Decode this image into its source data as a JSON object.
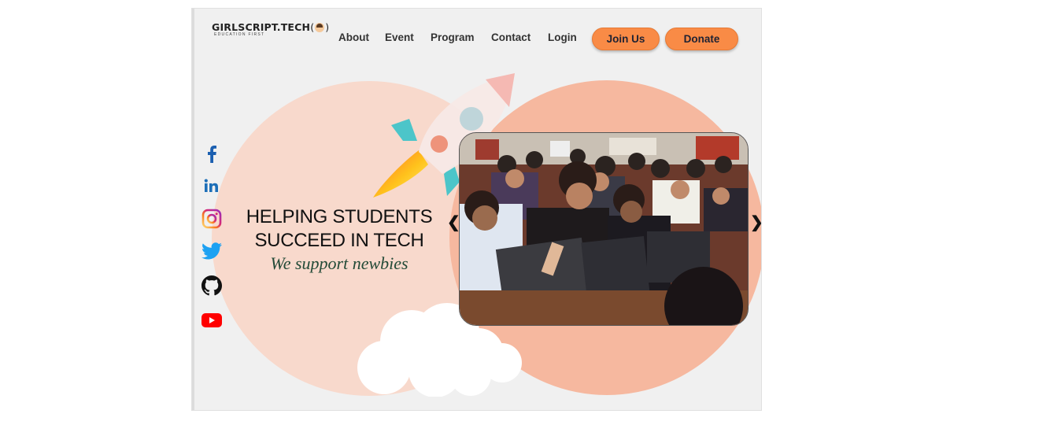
{
  "logo": {
    "name": "GIRLSCRIPT.TECH",
    "tagline": "EDUCATION FIRST"
  },
  "nav": [
    {
      "label": "About"
    },
    {
      "label": "Event"
    },
    {
      "label": "Program"
    },
    {
      "label": "Contact"
    },
    {
      "label": "Login"
    }
  ],
  "buttons": {
    "join": "Join Us",
    "donate": "Donate"
  },
  "hero": {
    "title_line1": "HELPING STUDENTS",
    "title_line2": "SUCCEED IN TECH",
    "subtitle": "We support newbies"
  },
  "social": [
    "facebook-icon",
    "linkedin-icon",
    "instagram-icon",
    "twitter-icon",
    "github-icon",
    "youtube-icon"
  ],
  "colors": {
    "accent": "#f98b46",
    "circle_left": "#f8d9cc",
    "circle_right": "#f6b89f",
    "subtitle": "#234a37"
  }
}
